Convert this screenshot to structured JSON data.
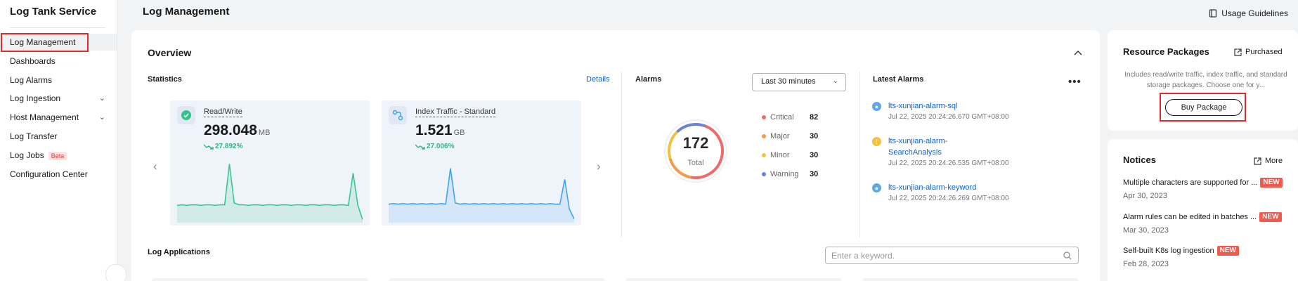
{
  "sidebar": {
    "title": "Log Tank Service",
    "items": [
      {
        "label": "Log Management",
        "expandable": false,
        "active": true
      },
      {
        "label": "Dashboards",
        "expandable": false
      },
      {
        "label": "Log Alarms",
        "expandable": false
      },
      {
        "label": "Log Ingestion",
        "expandable": true
      },
      {
        "label": "Host Management",
        "expandable": true
      },
      {
        "label": "Log Transfer",
        "expandable": false
      },
      {
        "label": "Log Jobs",
        "expandable": false,
        "badge": "Beta"
      },
      {
        "label": "Configuration Center",
        "expandable": false
      }
    ]
  },
  "header": {
    "title": "Log Management",
    "guide_link": "Usage Guidelines"
  },
  "overview": {
    "title": "Overview",
    "statistics": {
      "label": "Statistics",
      "details_link": "Details",
      "cards": [
        {
          "name": "Read/Write",
          "value": "298.048",
          "unit": "MB",
          "change": "27.892%",
          "icon": "leaf-icon",
          "color": "#31c48d",
          "trend": [
            0.28,
            0.29,
            0.28,
            0.29,
            0.29,
            0.28,
            0.29,
            0.29,
            0.28,
            0.29,
            0.29,
            0.95,
            0.32,
            0.29,
            0.29,
            0.28,
            0.29,
            0.29,
            0.28,
            0.29,
            0.29,
            0.28,
            0.29,
            0.29,
            0.28,
            0.29,
            0.29,
            0.28,
            0.29,
            0.29,
            0.28,
            0.29,
            0.29,
            0.28,
            0.29,
            0.29,
            0.28,
            0.8,
            0.28,
            0.05
          ]
        },
        {
          "name": "Index Traffic - Standard",
          "value": "1.521",
          "unit": "GB",
          "change": "27.006%",
          "icon": "flow-icon",
          "color": "#3aa0ec",
          "trend": [
            0.3,
            0.31,
            0.3,
            0.31,
            0.3,
            0.31,
            0.3,
            0.31,
            0.3,
            0.31,
            0.3,
            0.31,
            0.3,
            0.88,
            0.32,
            0.3,
            0.31,
            0.3,
            0.31,
            0.3,
            0.31,
            0.3,
            0.31,
            0.3,
            0.31,
            0.3,
            0.31,
            0.3,
            0.31,
            0.3,
            0.31,
            0.3,
            0.31,
            0.3,
            0.31,
            0.3,
            0.3,
            0.7,
            0.22,
            0.06
          ]
        }
      ]
    },
    "alarms": {
      "label": "Alarms",
      "time_range": "Last 30 minutes",
      "total": "172",
      "total_label": "Total",
      "severities": [
        {
          "name": "Critical",
          "count": "82",
          "color": "#ee6a6a"
        },
        {
          "name": "Major",
          "count": "30",
          "color": "#f29b4b"
        },
        {
          "name": "Minor",
          "count": "30",
          "color": "#f2c23e"
        },
        {
          "name": "Warning",
          "count": "30",
          "color": "#6b82d9"
        }
      ]
    },
    "latest_alarms": {
      "label": "Latest Alarms",
      "items": [
        {
          "name_lines": [
            "lts-xunjian-alarm-sql"
          ],
          "time": "Jul 22, 2025 20:24:26.670 GMT+08:00",
          "icon": "bell-icon",
          "color": "#5aa9f0"
        },
        {
          "name_lines": [
            "lts-xunjian-alarm-",
            "SearchAnalysis"
          ],
          "time": "Jul 22, 2025 20:24:26.535 GMT+08:00",
          "icon": "warning-icon",
          "color": "#f6c13a"
        },
        {
          "name_lines": [
            "lts-xunjian-alarm-keyword"
          ],
          "time": "Jul 22, 2025 20:24:26.269 GMT+08:00",
          "icon": "bell-icon",
          "color": "#5aa9f0"
        }
      ]
    }
  },
  "applications": {
    "label": "Log Applications",
    "search_placeholder": "Enter a keyword."
  },
  "resource_packages": {
    "title": "Resource Packages",
    "purchased_link": "Purchased",
    "description": "Includes read/write traffic, index traffic, and standard storage packages. Choose one for y...",
    "buy_button": "Buy Package"
  },
  "notices": {
    "title": "Notices",
    "more_link": "More",
    "items": [
      {
        "text": "Multiple characters are supported for ...",
        "badge": "NEW",
        "date": "Apr 30, 2023"
      },
      {
        "text": "Alarm rules can be edited in batches ...",
        "badge": "NEW",
        "date": "Mar 30, 2023"
      },
      {
        "text": "Self-built K8s log ingestion",
        "badge": "NEW",
        "date": "Feb 28, 2023"
      }
    ]
  }
}
